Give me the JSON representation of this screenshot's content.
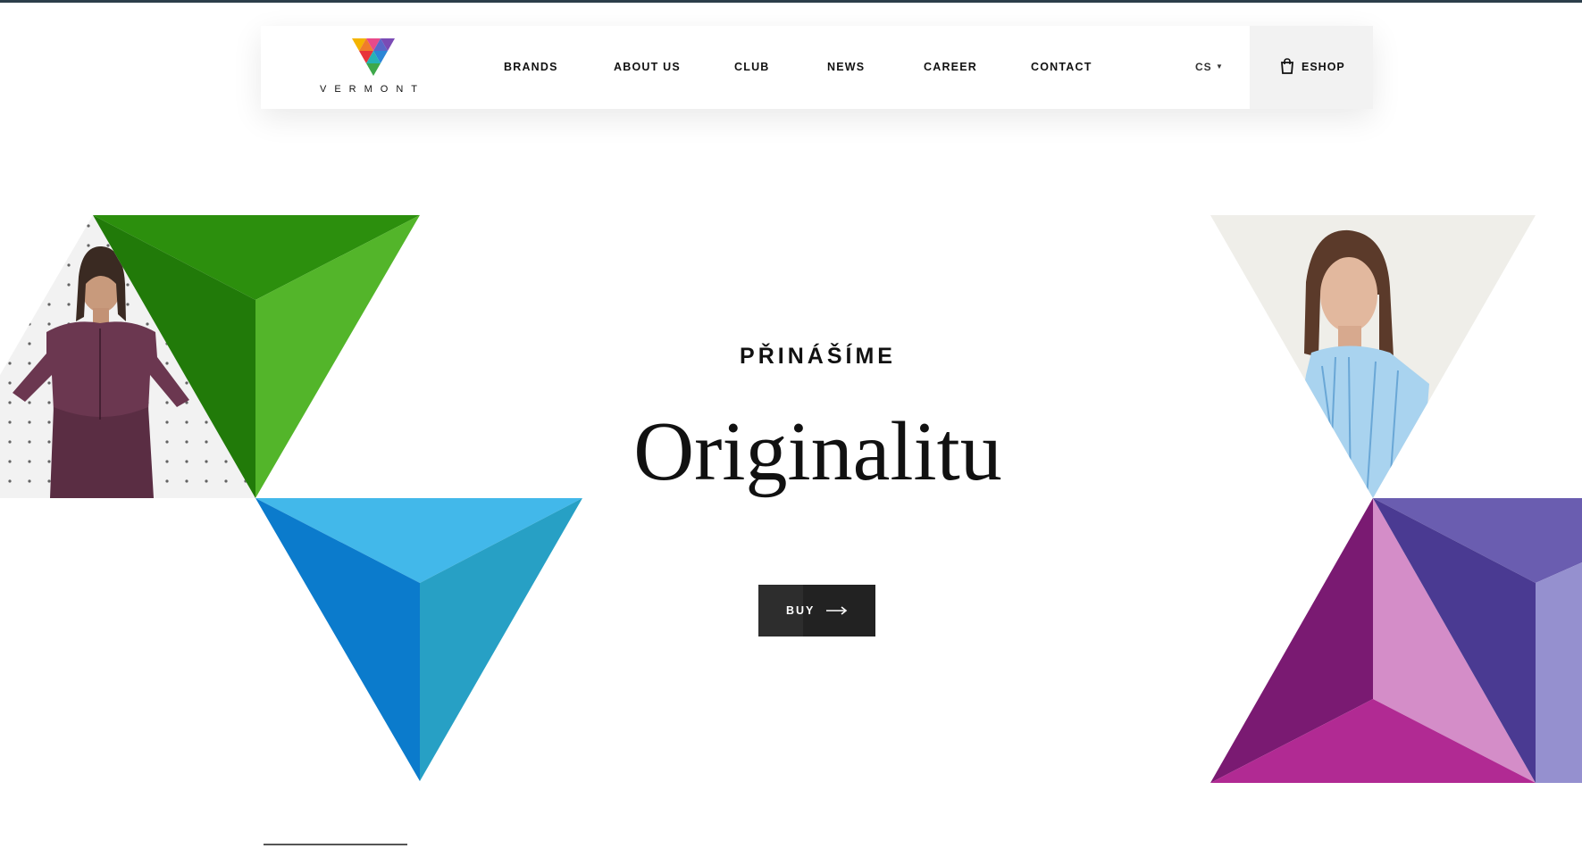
{
  "brand": {
    "name": "VERMONT"
  },
  "nav": {
    "items": [
      {
        "label": "BRANDS"
      },
      {
        "label": "ABOUT US"
      },
      {
        "label": "CLUB"
      },
      {
        "label": "NEWS"
      },
      {
        "label": "CAREER"
      },
      {
        "label": "CONTACT"
      }
    ],
    "language": "CS",
    "eshop_label": "ESHOP"
  },
  "hero": {
    "pretitle": "PŘINÁŠÍME",
    "title": "Originalitu",
    "button_label": "BUY"
  },
  "icons": {
    "logo": "vermont-v-logo-icon",
    "cart": "shopping-bag-icon",
    "caret": "caret-down-icon",
    "arrow": "arrow-right-icon"
  },
  "colors": {
    "green": "#2f8a10",
    "blue": "#1a8ed8",
    "purple": "#8c2a8a",
    "button": "#222222"
  }
}
